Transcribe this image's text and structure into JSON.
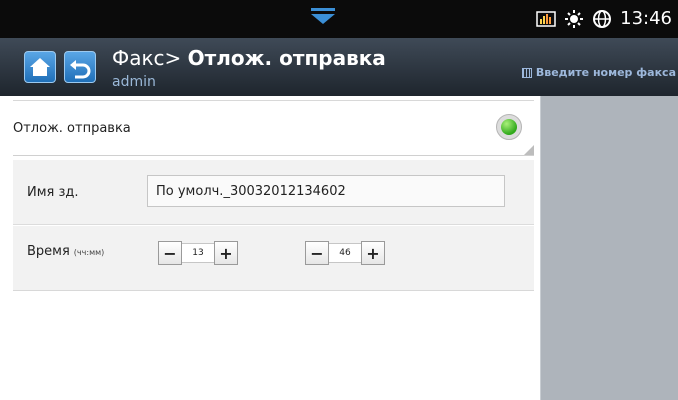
{
  "status": {
    "time": "13:46",
    "icons": [
      "equalizer-icon",
      "brightness-icon",
      "globe-icon"
    ]
  },
  "header": {
    "title_prefix": "Факс>",
    "title_main": "Отлож. отправка",
    "user": "admin",
    "fax_hint": "Введите номер факса"
  },
  "form": {
    "delayed_label": "Отлож. отправка",
    "delayed_enabled": true,
    "name_label": "Имя зд.",
    "name_value": "По умолч._30032012134602",
    "time_label": "Время",
    "time_format": "(чч:мм)",
    "hour": "13",
    "minute": "46",
    "minus": "−",
    "plus": "+"
  },
  "colors": {
    "accent": "#1f6fb8",
    "toggle_on": "#2fa81a"
  }
}
